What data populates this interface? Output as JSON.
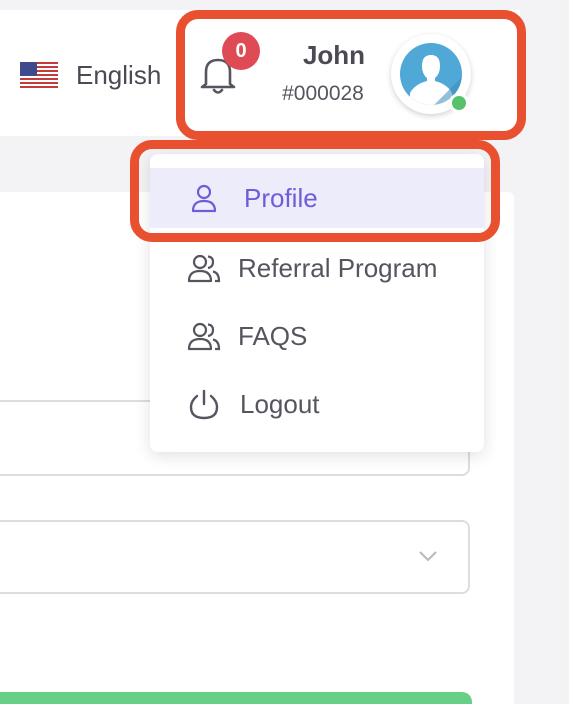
{
  "header": {
    "language": {
      "label": "English",
      "flag": "us-flag-icon"
    },
    "notifications": {
      "count": "0",
      "icon": "bell-icon"
    },
    "user": {
      "name": "John",
      "id": "#000028",
      "status": "online",
      "avatar": "user-avatar-icon"
    }
  },
  "dropdown": {
    "items": [
      {
        "label": "Profile",
        "icon": "user-icon",
        "active": true
      },
      {
        "label": "Referral Program",
        "icon": "users-icon",
        "active": false
      },
      {
        "label": "FAQS",
        "icon": "users-icon",
        "active": false
      },
      {
        "label": "Logout",
        "icon": "power-icon",
        "active": false
      }
    ]
  },
  "colors": {
    "accent": "#6d5ed8",
    "active_bg": "#ececfb",
    "badge": "#df4b55",
    "online": "#56c26b",
    "highlight": "#e8502f",
    "success_bar": "#68cf86"
  }
}
